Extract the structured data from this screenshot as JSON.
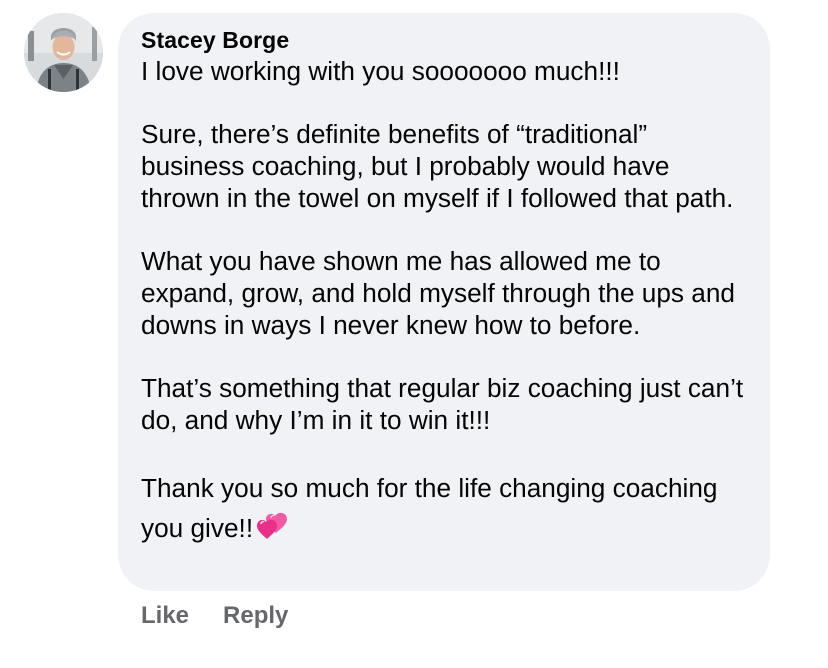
{
  "comment": {
    "author": "Stacey Borge",
    "paragraphs": [
      "I love working with you sooooooo much!!!",
      "Sure, there’s definite benefits of “traditional” business coaching, but I probably would have thrown in the towel on myself if I followed that path.",
      "What you have shown me has allowed me to expand, grow, and hold myself through the ups and downs in ways I never knew how to before.",
      "That’s something that regular biz coaching just can’t do, and why I’m in it to win it!!!"
    ],
    "last_paragraph": "Thank you so much for the life changing coaching you give!!",
    "emoji": "two-hearts-icon"
  },
  "actions": {
    "like_label": "Like",
    "reply_label": "Reply"
  },
  "colors": {
    "bubble_bg": "#f0f2f5",
    "text": "#050505",
    "action_text": "#65676b",
    "heart": "#f0509b"
  }
}
